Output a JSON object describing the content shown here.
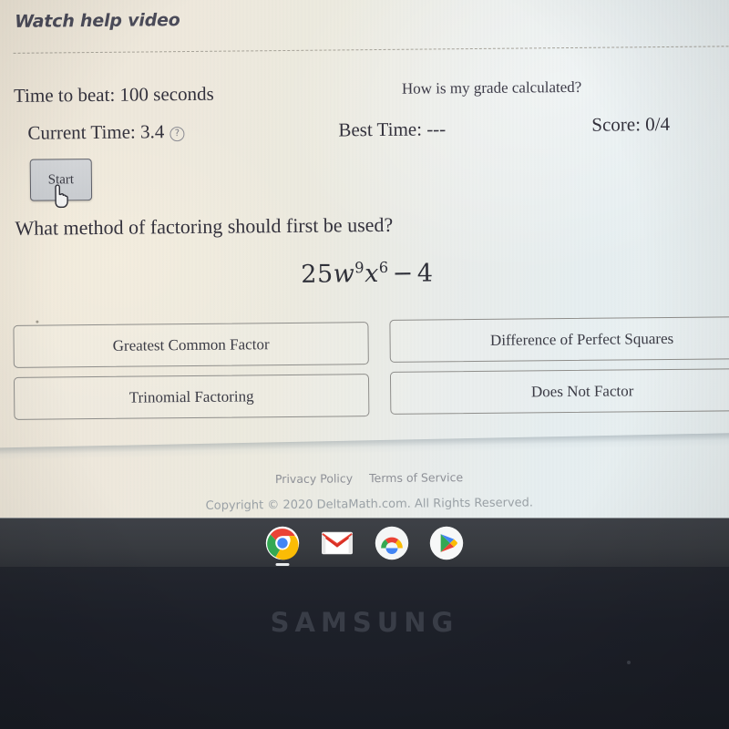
{
  "header": {
    "watch_help_video": "Watch help video"
  },
  "status": {
    "time_to_beat": "Time to beat: 100 seconds",
    "current_time_label": "Current Time: 3.4",
    "help_icon_glyph": "?",
    "grade_link": "How is my grade calculated?",
    "best_time": "Best Time: ---",
    "score": "Score: 0/4",
    "start_button": "Start"
  },
  "question": {
    "prompt": "What method of factoring should first be used?",
    "expression_plain": "25w^9 x^6 - 4",
    "expression": {
      "coefficient": "25",
      "var1": "w",
      "exp1": "9",
      "var2": "x",
      "exp2": "6",
      "operator": "−",
      "constant": "4"
    },
    "choices": [
      {
        "id": "gcf",
        "label": "Greatest Common Factor"
      },
      {
        "id": "dops",
        "label": "Difference of Perfect Squares"
      },
      {
        "id": "tri",
        "label": "Trinomial Factoring"
      },
      {
        "id": "dnf",
        "label": "Does Not Factor"
      }
    ]
  },
  "footer": {
    "privacy_policy": "Privacy Policy",
    "terms_of_service": "Terms of Service",
    "copyright": "Copyright © 2020 DeltaMath.com. All Rights Reserved."
  },
  "shelf": {
    "items": [
      {
        "name": "chrome-icon",
        "active": true
      },
      {
        "name": "gmail-icon",
        "active": false
      },
      {
        "name": "google-arc-icon",
        "active": false
      },
      {
        "name": "play-store-icon",
        "active": false
      }
    ]
  },
  "device": {
    "brand": "SAMSUNG"
  },
  "colors": {
    "screen_warm": "#efe7d8",
    "screen_cool": "#e9f0f1",
    "text": "#33313c",
    "muted_text": "#9aa1a6",
    "button_border": "#8e8d8a",
    "start_button_bg": "#d0d3d7",
    "shelf_bg": "#3a3d42",
    "bezel_bg": "#1d2029",
    "samsung_logo": "#3b3f49"
  }
}
